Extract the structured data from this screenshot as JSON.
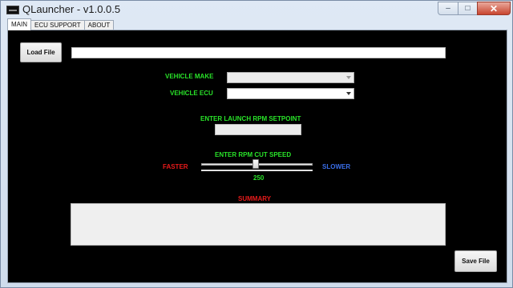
{
  "window": {
    "title": "QLauncher - v1.0.0.5",
    "controls": {
      "minimize": "–",
      "maximize": "□",
      "close": "✕"
    }
  },
  "tabs": [
    {
      "label": "MAIN",
      "active": true
    },
    {
      "label": "ECU SUPPORT",
      "active": false
    },
    {
      "label": "ABOUT",
      "active": false
    }
  ],
  "main": {
    "load_button": "Load File",
    "file_path": "",
    "vehicle_make": {
      "label": "VEHICLE MAKE",
      "value": ""
    },
    "vehicle_ecu": {
      "label": "VEHICLE ECU",
      "value": ""
    },
    "launch_rpm": {
      "label": "ENTER LAUNCH RPM SETPOINT",
      "value": ""
    },
    "rpm_cut": {
      "label": "ENTER RPM CUT SPEED",
      "left_label": "FASTER",
      "right_label": "SLOWER",
      "value": "250",
      "slider_fraction": 0.5
    },
    "summary": {
      "label": "SUMMARY",
      "value": ""
    },
    "save_button": "Save File"
  },
  "colors": {
    "panel_bg": "#000000",
    "label_green": "#29e329",
    "label_red": "#e81a1a",
    "label_blue": "#3a6ee8"
  }
}
